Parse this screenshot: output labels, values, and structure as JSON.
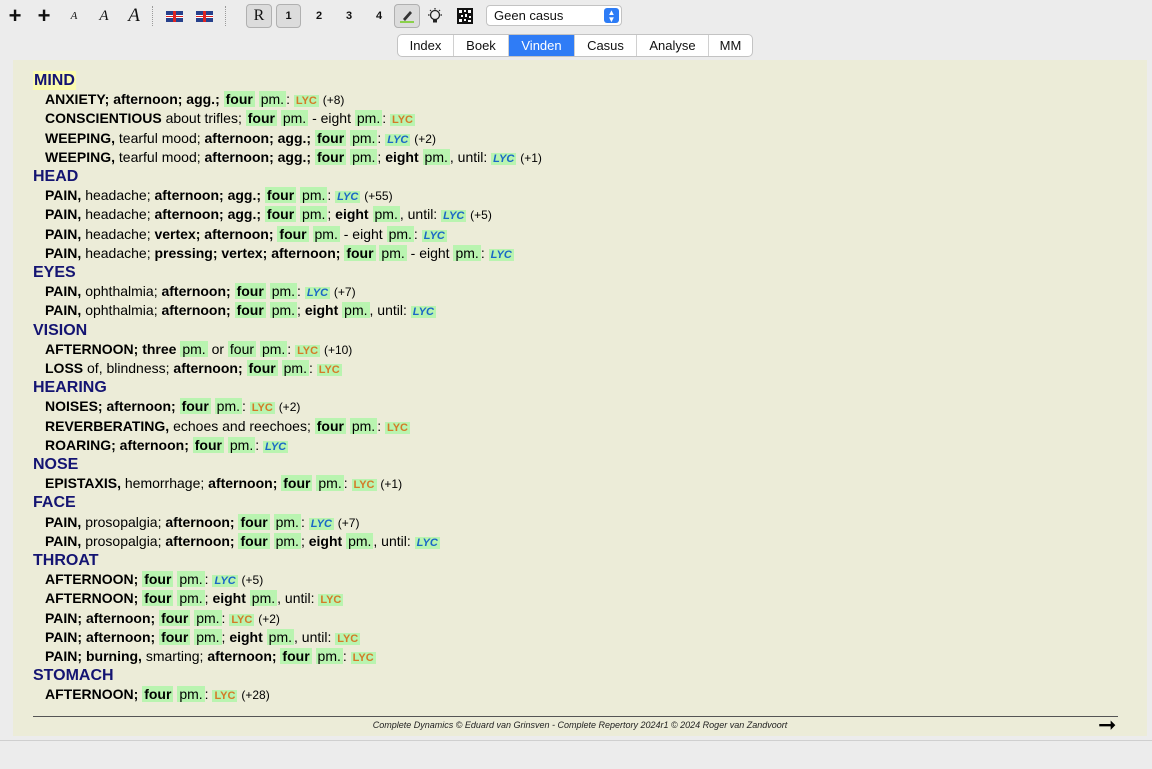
{
  "toolbar": {
    "text_letter": "A",
    "repertory_button": "R",
    "num_buttons": [
      "1",
      "2",
      "3",
      "4"
    ],
    "case_select": "Geen casus"
  },
  "tabs": [
    "Index",
    "Boek",
    "Vinden",
    "Casus",
    "Analyse",
    "MM"
  ],
  "active_tab": "Vinden",
  "chapters": [
    {
      "name": "MIND",
      "rubrics": [
        {
          "segments": [
            {
              "t": "ANXIETY; afternoon; agg.; ",
              "b": true
            },
            {
              "t": "four",
              "b": true,
              "g": true
            },
            {
              "t": " "
            },
            {
              "t": "pm.",
              "g": true
            },
            {
              "t": ": "
            }
          ],
          "remedy": "LYC",
          "grade": 1,
          "count": "(+8)"
        },
        {
          "segments": [
            {
              "t": "CONSCIENTIOUS",
              "b": true
            },
            {
              "t": " about trifles; "
            },
            {
              "t": "four",
              "b": true,
              "g": true
            },
            {
              "t": " "
            },
            {
              "t": "pm.",
              "g": true
            },
            {
              "t": " - eight "
            },
            {
              "t": "pm.",
              "g": true
            },
            {
              "t": ": "
            }
          ],
          "remedy": "LYC",
          "grade": 1,
          "count": ""
        },
        {
          "segments": [
            {
              "t": "WEEPING,",
              "b": true
            },
            {
              "t": " tearful mood; "
            },
            {
              "t": "afternoon; agg.; ",
              "b": true
            },
            {
              "t": "four",
              "b": true,
              "g": true
            },
            {
              "t": " "
            },
            {
              "t": "pm.",
              "g": true
            },
            {
              "t": ": "
            }
          ],
          "remedy": "LYC",
          "grade": 2,
          "count": "(+2)"
        },
        {
          "segments": [
            {
              "t": "WEEPING,",
              "b": true
            },
            {
              "t": " tearful mood; "
            },
            {
              "t": "afternoon; agg.; ",
              "b": true
            },
            {
              "t": "four",
              "b": true,
              "g": true
            },
            {
              "t": " "
            },
            {
              "t": "pm.",
              "g": true
            },
            {
              "t": "; "
            },
            {
              "t": "eight",
              "b": true
            },
            {
              "t": " "
            },
            {
              "t": "pm.",
              "g": true
            },
            {
              "t": ", until: "
            }
          ],
          "remedy": "LYC",
          "grade": 2,
          "count": "(+1)"
        }
      ]
    },
    {
      "name": "HEAD",
      "rubrics": [
        {
          "segments": [
            {
              "t": "PAIN,",
              "b": true
            },
            {
              "t": " headache; "
            },
            {
              "t": "afternoon; agg.; ",
              "b": true
            },
            {
              "t": "four",
              "b": true,
              "g": true
            },
            {
              "t": " "
            },
            {
              "t": "pm.",
              "g": true
            },
            {
              "t": ": "
            }
          ],
          "remedy": "LYC",
          "grade": 2,
          "count": "(+55)"
        },
        {
          "segments": [
            {
              "t": "PAIN,",
              "b": true
            },
            {
              "t": " headache; "
            },
            {
              "t": "afternoon; agg.; ",
              "b": true
            },
            {
              "t": "four",
              "b": true,
              "g": true
            },
            {
              "t": " "
            },
            {
              "t": "pm.",
              "g": true
            },
            {
              "t": "; "
            },
            {
              "t": "eight",
              "b": true
            },
            {
              "t": " "
            },
            {
              "t": "pm.",
              "g": true
            },
            {
              "t": ", until: "
            }
          ],
          "remedy": "LYC",
          "grade": 2,
          "count": "(+5)"
        },
        {
          "segments": [
            {
              "t": "PAIN,",
              "b": true
            },
            {
              "t": " headache; "
            },
            {
              "t": "vertex; afternoon; ",
              "b": true
            },
            {
              "t": "four",
              "b": true,
              "g": true
            },
            {
              "t": " "
            },
            {
              "t": "pm.",
              "g": true
            },
            {
              "t": " - eight "
            },
            {
              "t": "pm.",
              "g": true
            },
            {
              "t": ": "
            }
          ],
          "remedy": "LYC",
          "grade": 2,
          "count": ""
        },
        {
          "segments": [
            {
              "t": "PAIN,",
              "b": true
            },
            {
              "t": " headache; "
            },
            {
              "t": "pressing; vertex; afternoon; ",
              "b": true
            },
            {
              "t": "four",
              "b": true,
              "g": true
            },
            {
              "t": " "
            },
            {
              "t": "pm.",
              "g": true
            },
            {
              "t": " - eight "
            },
            {
              "t": "pm.",
              "g": true
            },
            {
              "t": ": "
            }
          ],
          "remedy": "LYC",
          "grade": 2,
          "count": ""
        }
      ]
    },
    {
      "name": "EYES",
      "rubrics": [
        {
          "segments": [
            {
              "t": "PAIN,",
              "b": true
            },
            {
              "t": " ophthalmia; "
            },
            {
              "t": "afternoon; ",
              "b": true
            },
            {
              "t": "four",
              "b": true,
              "g": true
            },
            {
              "t": " "
            },
            {
              "t": "pm.",
              "g": true
            },
            {
              "t": ": "
            }
          ],
          "remedy": "LYC",
          "grade": 2,
          "count": "(+7)"
        },
        {
          "segments": [
            {
              "t": "PAIN,",
              "b": true
            },
            {
              "t": " ophthalmia; "
            },
            {
              "t": "afternoon; ",
              "b": true
            },
            {
              "t": "four",
              "b": true,
              "g": true
            },
            {
              "t": " "
            },
            {
              "t": "pm.",
              "g": true
            },
            {
              "t": "; "
            },
            {
              "t": "eight",
              "b": true
            },
            {
              "t": " "
            },
            {
              "t": "pm.",
              "g": true
            },
            {
              "t": ", until: "
            }
          ],
          "remedy": "LYC",
          "grade": 2,
          "count": ""
        }
      ]
    },
    {
      "name": "VISION",
      "rubrics": [
        {
          "segments": [
            {
              "t": "AFTERNOON; three",
              "b": true
            },
            {
              "t": " "
            },
            {
              "t": "pm.",
              "g": true
            },
            {
              "t": " or "
            },
            {
              "t": "four",
              "g": true
            },
            {
              "t": " "
            },
            {
              "t": "pm.",
              "g": true
            },
            {
              "t": ": "
            }
          ],
          "remedy": "LYC",
          "grade": 1,
          "count": "(+10)"
        },
        {
          "segments": [
            {
              "t": "LOSS",
              "b": true
            },
            {
              "t": " of, blindness; "
            },
            {
              "t": "afternoon; ",
              "b": true
            },
            {
              "t": "four",
              "b": true,
              "g": true
            },
            {
              "t": " "
            },
            {
              "t": "pm.",
              "g": true
            },
            {
              "t": ": "
            }
          ],
          "remedy": "LYC",
          "grade": 1,
          "count": ""
        }
      ]
    },
    {
      "name": "HEARING",
      "rubrics": [
        {
          "segments": [
            {
              "t": "NOISES; afternoon; ",
              "b": true
            },
            {
              "t": "four",
              "b": true,
              "g": true
            },
            {
              "t": " "
            },
            {
              "t": "pm.",
              "g": true
            },
            {
              "t": ": "
            }
          ],
          "remedy": "LYC",
          "grade": 1,
          "count": "(+2)"
        },
        {
          "segments": [
            {
              "t": "REVERBERATING,",
              "b": true
            },
            {
              "t": " echoes and reechoes; "
            },
            {
              "t": "four",
              "b": true,
              "g": true
            },
            {
              "t": " "
            },
            {
              "t": "pm.",
              "g": true
            },
            {
              "t": ": "
            }
          ],
          "remedy": "LYC",
          "grade": 1,
          "count": ""
        },
        {
          "segments": [
            {
              "t": "ROARING; afternoon; ",
              "b": true
            },
            {
              "t": "four",
              "b": true,
              "g": true
            },
            {
              "t": " "
            },
            {
              "t": "pm.",
              "g": true
            },
            {
              "t": ": "
            }
          ],
          "remedy": "LYC",
          "grade": 2,
          "count": ""
        }
      ]
    },
    {
      "name": "NOSE",
      "rubrics": [
        {
          "segments": [
            {
              "t": "EPISTAXIS,",
              "b": true
            },
            {
              "t": " hemorrhage; "
            },
            {
              "t": "afternoon; ",
              "b": true
            },
            {
              "t": "four",
              "b": true,
              "g": true
            },
            {
              "t": " "
            },
            {
              "t": "pm.",
              "g": true
            },
            {
              "t": ": "
            }
          ],
          "remedy": "LYC",
          "grade": 1,
          "count": "(+1)"
        }
      ]
    },
    {
      "name": "FACE",
      "rubrics": [
        {
          "segments": [
            {
              "t": "PAIN,",
              "b": true
            },
            {
              "t": " prosopalgia; "
            },
            {
              "t": "afternoon; ",
              "b": true
            },
            {
              "t": "four",
              "b": true,
              "g": true
            },
            {
              "t": " "
            },
            {
              "t": "pm.",
              "g": true
            },
            {
              "t": ": "
            }
          ],
          "remedy": "LYC",
          "grade": 2,
          "count": "(+7)"
        },
        {
          "segments": [
            {
              "t": "PAIN,",
              "b": true
            },
            {
              "t": " prosopalgia; "
            },
            {
              "t": "afternoon; ",
              "b": true
            },
            {
              "t": "four",
              "b": true,
              "g": true
            },
            {
              "t": " "
            },
            {
              "t": "pm.",
              "g": true
            },
            {
              "t": "; "
            },
            {
              "t": "eight",
              "b": true
            },
            {
              "t": " "
            },
            {
              "t": "pm.",
              "g": true
            },
            {
              "t": ", until: "
            }
          ],
          "remedy": "LYC",
          "grade": 2,
          "count": ""
        }
      ]
    },
    {
      "name": "THROAT",
      "rubrics": [
        {
          "segments": [
            {
              "t": "AFTERNOON; ",
              "b": true
            },
            {
              "t": "four",
              "b": true,
              "g": true
            },
            {
              "t": " "
            },
            {
              "t": "pm.",
              "g": true
            },
            {
              "t": ": "
            }
          ],
          "remedy": "LYC",
          "grade": 2,
          "count": "(+5)"
        },
        {
          "segments": [
            {
              "t": "AFTERNOON; ",
              "b": true
            },
            {
              "t": "four",
              "b": true,
              "g": true
            },
            {
              "t": " "
            },
            {
              "t": "pm.",
              "g": true
            },
            {
              "t": "; "
            },
            {
              "t": "eight",
              "b": true
            },
            {
              "t": " "
            },
            {
              "t": "pm.",
              "g": true
            },
            {
              "t": ", until: "
            }
          ],
          "remedy": "LYC",
          "grade": 1,
          "count": ""
        },
        {
          "segments": [
            {
              "t": "PAIN; afternoon; ",
              "b": true
            },
            {
              "t": "four",
              "b": true,
              "g": true
            },
            {
              "t": " "
            },
            {
              "t": "pm.",
              "g": true
            },
            {
              "t": ": "
            }
          ],
          "remedy": "LYC",
          "grade": 1,
          "count": "(+2)"
        },
        {
          "segments": [
            {
              "t": "PAIN; afternoon; ",
              "b": true
            },
            {
              "t": "four",
              "b": true,
              "g": true
            },
            {
              "t": " "
            },
            {
              "t": "pm.",
              "g": true
            },
            {
              "t": "; "
            },
            {
              "t": "eight",
              "b": true
            },
            {
              "t": " "
            },
            {
              "t": "pm.",
              "g": true
            },
            {
              "t": ", until: "
            }
          ],
          "remedy": "LYC",
          "grade": 1,
          "count": ""
        },
        {
          "segments": [
            {
              "t": "PAIN; burning,",
              "b": true
            },
            {
              "t": " smarting; "
            },
            {
              "t": "afternoon; ",
              "b": true
            },
            {
              "t": "four",
              "b": true,
              "g": true
            },
            {
              "t": " "
            },
            {
              "t": "pm.",
              "g": true
            },
            {
              "t": ": "
            }
          ],
          "remedy": "LYC",
          "grade": 1,
          "count": ""
        }
      ]
    },
    {
      "name": "STOMACH",
      "rubrics": [
        {
          "segments": [
            {
              "t": "AFTERNOON; ",
              "b": true
            },
            {
              "t": "four",
              "b": true,
              "g": true
            },
            {
              "t": " "
            },
            {
              "t": "pm.",
              "g": true
            },
            {
              "t": ": "
            }
          ],
          "remedy": "LYC",
          "grade": 1,
          "count": "(+28)"
        }
      ]
    }
  ],
  "footer": "Complete Dynamics © Eduard van Grinsven   -   Complete Repertory 2024r1 © 2024 Roger van Zandvoort",
  "colors": {
    "content_bg": "#ececd8",
    "chapter_text": "#141472",
    "highlight_green": "#b9f4b0",
    "highlight_yellow": "#fbfbb0",
    "remedy_grade1": "#d47a28",
    "remedy_grade2": "#1a66c7",
    "tab_active": "#2f7cf6"
  },
  "icons": {
    "add1": "plus-icon",
    "add2": "plus-icon",
    "highlight": "marker-pen-icon",
    "hint": "lightbulb-icon",
    "qr": "qr-grid-icon",
    "next": "arrow-right-icon",
    "flag1": "uk-flag-icon",
    "flag2": "uk-flag-icon"
  }
}
